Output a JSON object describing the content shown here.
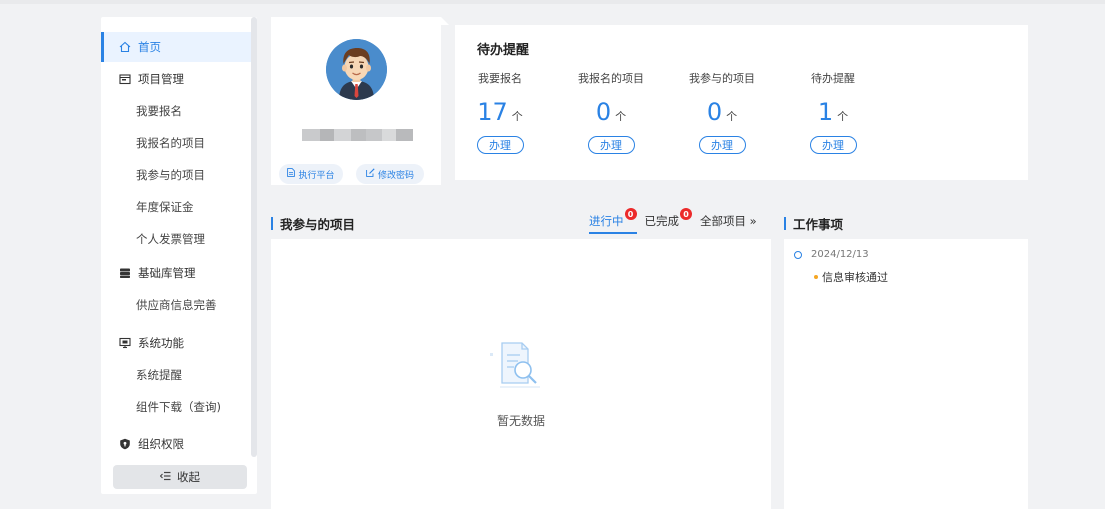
{
  "sidebar": {
    "items": [
      {
        "label": "首页",
        "icon": "home-icon"
      },
      {
        "label": "项目管理",
        "icon": "folder-icon"
      },
      {
        "label": "我要报名"
      },
      {
        "label": "我报名的项目"
      },
      {
        "label": "我参与的项目"
      },
      {
        "label": "年度保证金"
      },
      {
        "label": "个人发票管理"
      },
      {
        "label": "基础库管理",
        "icon": "database-icon"
      },
      {
        "label": "供应商信息完善"
      },
      {
        "label": "系统功能",
        "icon": "monitor-icon"
      },
      {
        "label": "系统提醒"
      },
      {
        "label": "组件下载（查询)"
      },
      {
        "label": "组织权限",
        "icon": "shield-icon"
      }
    ],
    "collapse_label": "收起"
  },
  "profile": {
    "platform_button": "执行平台",
    "password_button": "修改密码"
  },
  "todo": {
    "title": "待办提醒",
    "columns": [
      {
        "label": "我要报名",
        "count": "17",
        "unit": "个",
        "action": "办理"
      },
      {
        "label": "我报名的项目",
        "count": "0",
        "unit": "个",
        "action": "办理"
      },
      {
        "label": "我参与的项目",
        "count": "0",
        "unit": "个",
        "action": "办理"
      },
      {
        "label": "待办提醒",
        "count": "1",
        "unit": "个",
        "action": "办理"
      }
    ]
  },
  "projects": {
    "title": "我参与的项目",
    "tabs": [
      {
        "label": "进行中",
        "badge": "0"
      },
      {
        "label": "已完成",
        "badge": "0"
      },
      {
        "label": "全部项目 »"
      }
    ],
    "empty_text": "暂无数据"
  },
  "work": {
    "title": "工作事项",
    "date": "2024/12/13",
    "item": "信息审核通过"
  },
  "colors": {
    "accent": "#2a82e4",
    "badge": "#ec2a2a",
    "bullet": "#f5a623",
    "background": "#f1f2f4"
  }
}
